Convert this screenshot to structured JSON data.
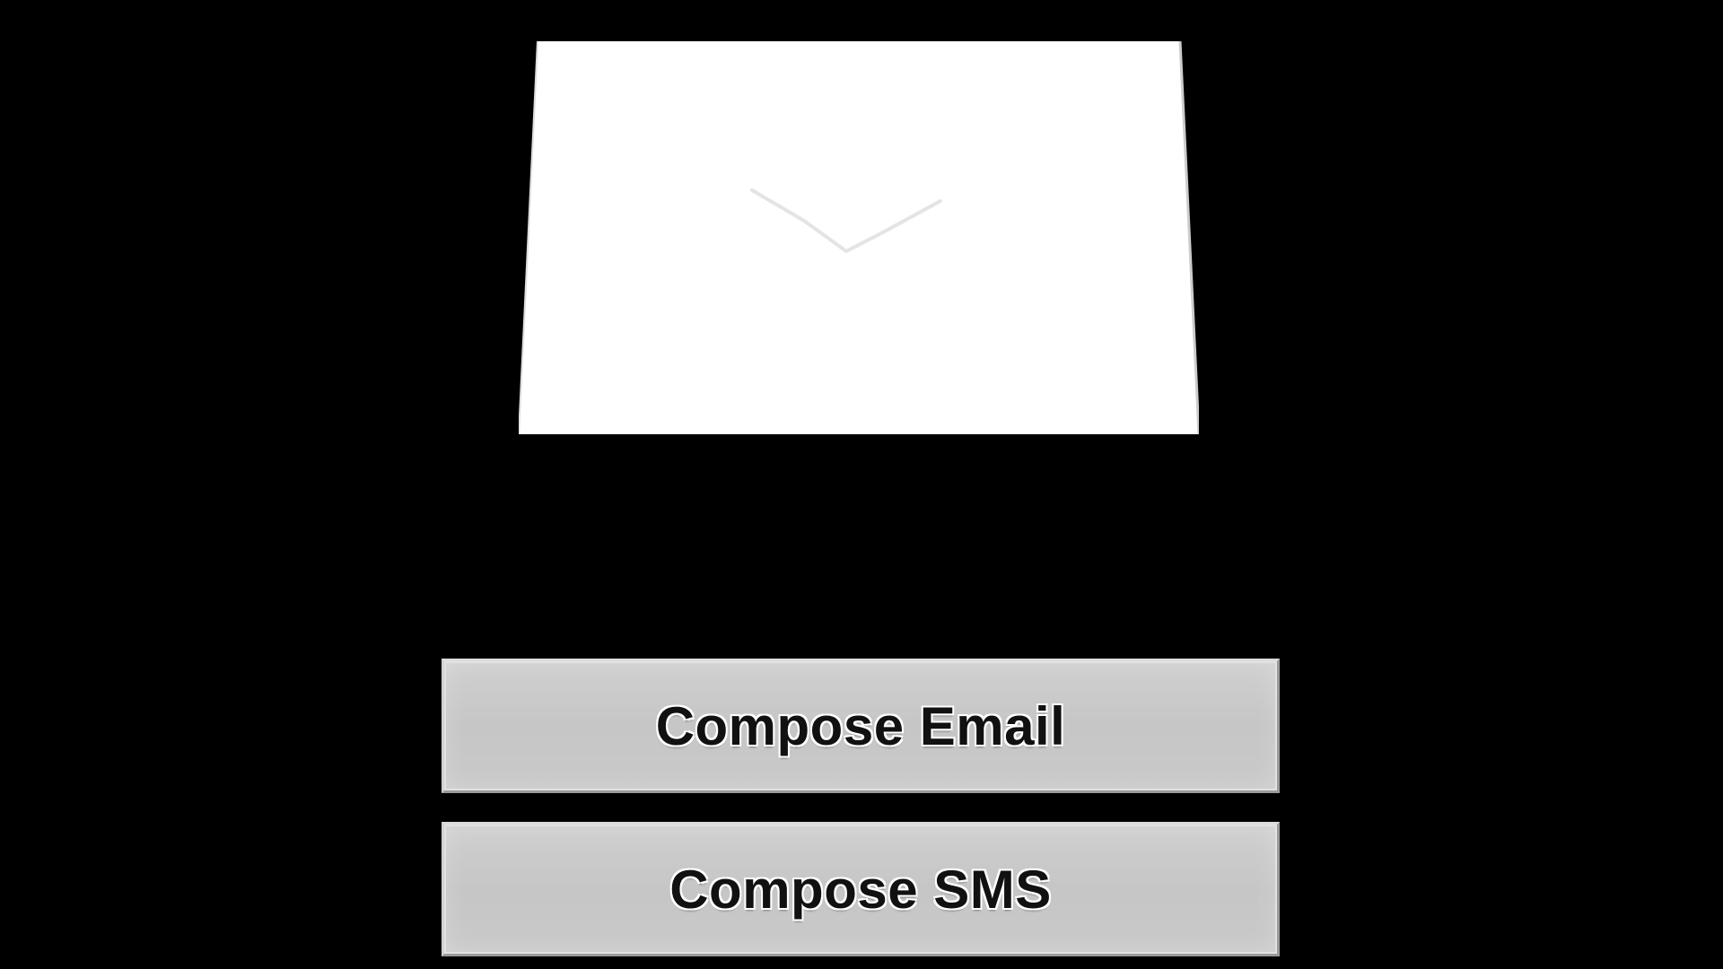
{
  "envelope": {
    "icon": "envelope-icon",
    "fill": "#ffffff"
  },
  "buttons": {
    "compose_email_label": "Compose Email",
    "compose_sms_label": "Compose SMS"
  },
  "colors": {
    "background": "#000000",
    "button_face": "#c9c9c9",
    "button_text": "#111111"
  }
}
